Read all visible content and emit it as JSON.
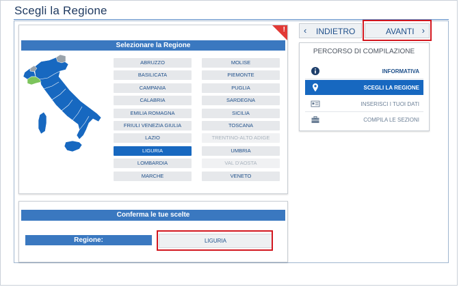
{
  "page": {
    "title": "Scegli la Regione"
  },
  "region_panel": {
    "header": "Selezionare la Regione",
    "warning_mark": "!",
    "regions": [
      {
        "label": "ABRUZZO",
        "state": "normal"
      },
      {
        "label": "MOLISE",
        "state": "normal"
      },
      {
        "label": "BASILICATA",
        "state": "normal"
      },
      {
        "label": "PIEMONTE",
        "state": "normal"
      },
      {
        "label": "CAMPANIA",
        "state": "normal"
      },
      {
        "label": "PUGLIA",
        "state": "normal"
      },
      {
        "label": "CALABRIA",
        "state": "normal"
      },
      {
        "label": "SARDEGNA",
        "state": "normal"
      },
      {
        "label": "EMILIA ROMAGNA",
        "state": "normal"
      },
      {
        "label": "SICILIA",
        "state": "normal"
      },
      {
        "label": "FRIULI VENEZIA GIULIA",
        "state": "normal"
      },
      {
        "label": "TOSCANA",
        "state": "normal"
      },
      {
        "label": "LAZIO",
        "state": "normal"
      },
      {
        "label": "TRENTINO-ALTO ADIGE",
        "state": "disabled"
      },
      {
        "label": "LIGURIA",
        "state": "selected"
      },
      {
        "label": "UMBRIA",
        "state": "normal"
      },
      {
        "label": "LOMBARDIA",
        "state": "normal"
      },
      {
        "label": "VAL D'AOSTA",
        "state": "disabled"
      },
      {
        "label": "MARCHE",
        "state": "normal"
      },
      {
        "label": "VENETO",
        "state": "normal"
      }
    ]
  },
  "confirm_panel": {
    "header": "Conferma le tue scelte",
    "region_label": "Regione:",
    "region_value": "LIGURIA"
  },
  "nav": {
    "back_label": "INDIETRO",
    "back_icon": "chevron-left-icon",
    "next_label": "AVANTI",
    "next_icon": "chevron-right-icon"
  },
  "steps": {
    "title": "PERCORSO DI COMPILAZIONE",
    "items": [
      {
        "label": "INFORMATIVA",
        "icon": "info-icon",
        "state": "done"
      },
      {
        "label": "SCEGLI LA REGIONE",
        "icon": "map-pin-icon",
        "state": "active"
      },
      {
        "label": "INSERISCI I TUOI DATI",
        "icon": "id-card-icon",
        "state": "inactive"
      },
      {
        "label": "COMPILA LE SEZIONI",
        "icon": "briefcase-icon",
        "state": "inactive"
      }
    ]
  },
  "colors": {
    "primary": "#1768c0",
    "header_bar": "#3a78c0",
    "highlight": "#d2161e",
    "map_fill": "#1768c0",
    "map_selected": "#7cc45c",
    "map_disabled": "#9aa3ab"
  }
}
